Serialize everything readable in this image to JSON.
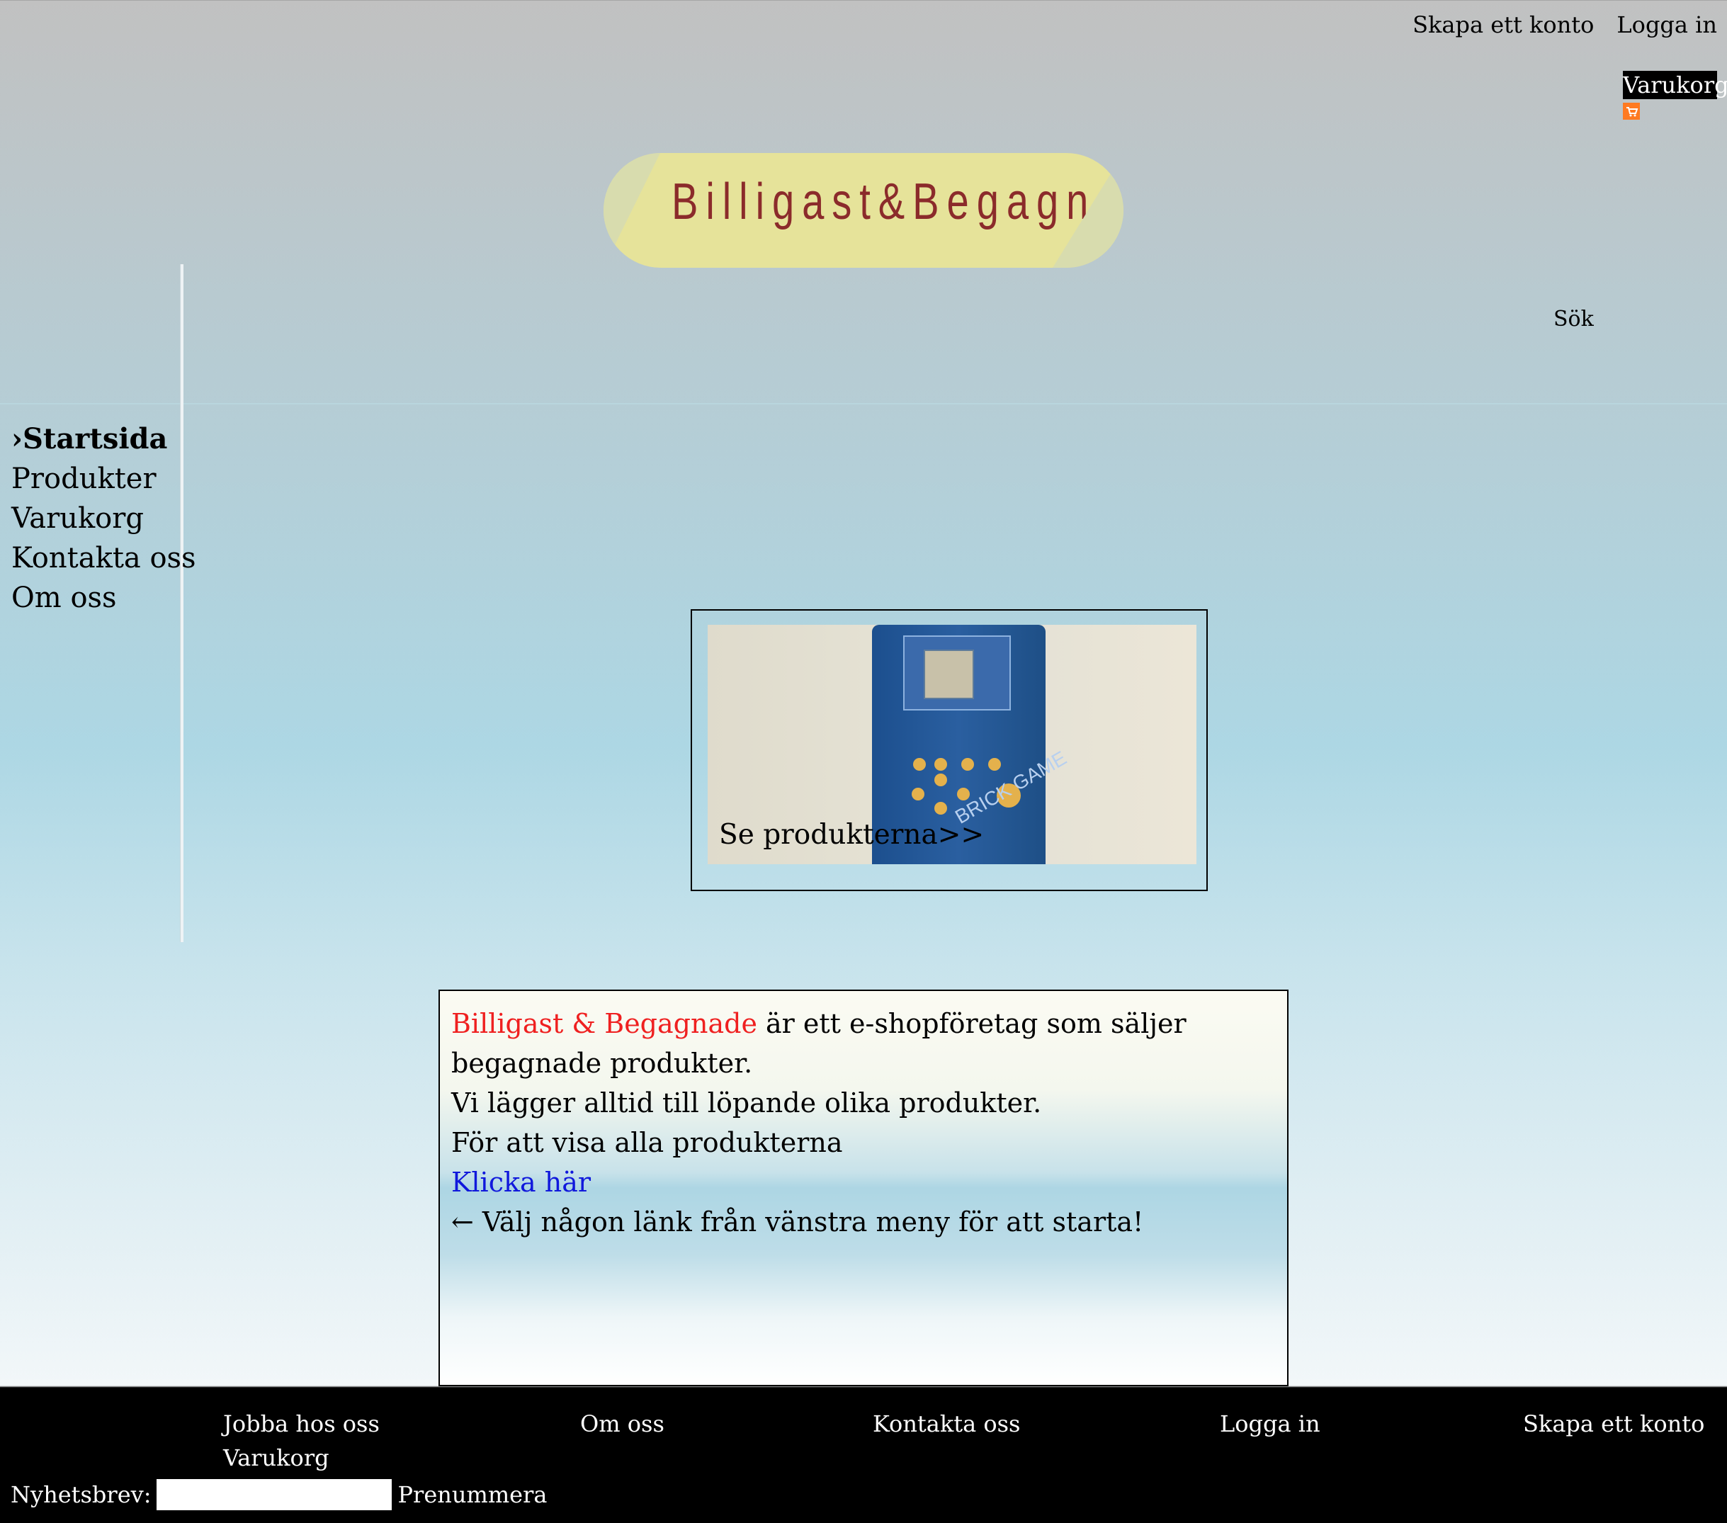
{
  "header": {
    "top_links": [
      "Skapa ett konto",
      "Logga in"
    ],
    "cart_label": "Varukorg",
    "logo_text": "Billigast&Begagnat",
    "search_label": "Sök"
  },
  "sidebar": {
    "items": [
      {
        "label": "›Startsida",
        "active": true
      },
      {
        "label": "Produkter",
        "active": false
      },
      {
        "label": "Varukorg",
        "active": false
      },
      {
        "label": "Kontakta oss",
        "active": false
      },
      {
        "label": "Om oss",
        "active": false
      }
    ]
  },
  "product_card": {
    "cta": "Se produkterna>>",
    "device_text": "BRICK GAME"
  },
  "info": {
    "brand": "Billigast & Begagnade",
    "line1_rest": " är ett e-shopföretag som säljer begagnade produkter.",
    "line2": "Vi lägger alltid till löpande olika produkter.",
    "line3": "För att visa alla produkterna",
    "link": "Klicka här",
    "line4": "← Välj någon länk från vänstra meny för att starta!"
  },
  "footer": {
    "links": [
      "Jobba hos oss",
      "Om oss",
      "Kontakta oss",
      "Logga in",
      "Skapa ett konto",
      "Varukorg"
    ],
    "newsletter_label": "Nyhetsbrev:",
    "newsletter_placeholder": "",
    "subscribe_label": "Prenummera"
  },
  "colors": {
    "brand_red": "#ef2020",
    "link_blue": "#1018dc",
    "logo_yellow": "#e6e39a",
    "logo_text": "#8b2b2b"
  }
}
